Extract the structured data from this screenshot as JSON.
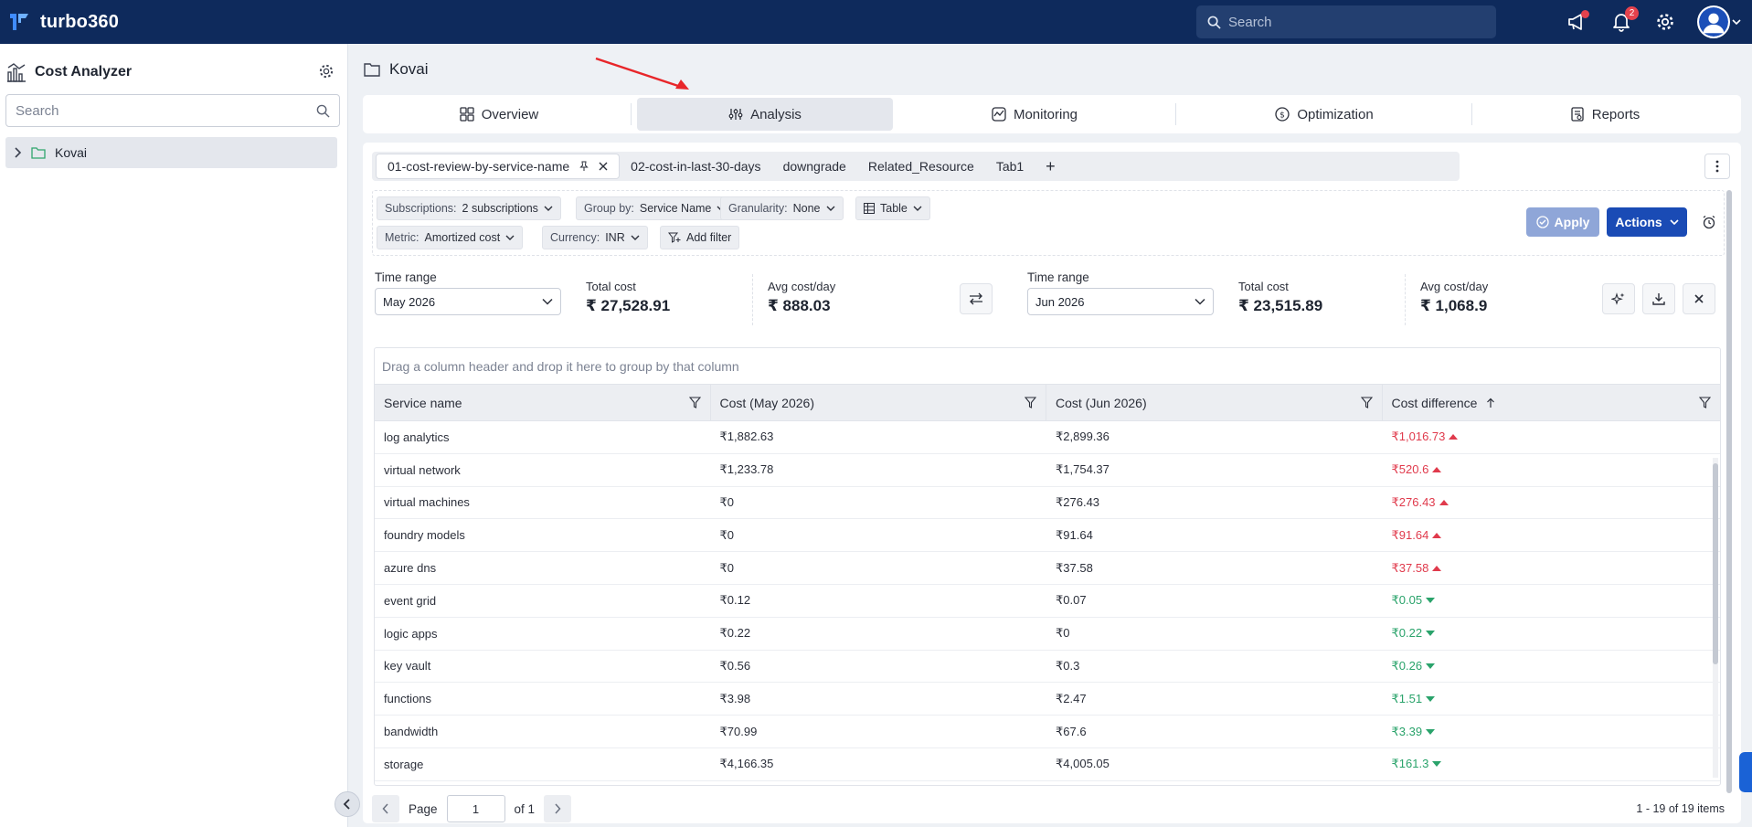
{
  "app": {
    "logo_text": "turbo360"
  },
  "topbar": {
    "search_placeholder": "Search",
    "notification_count": "2",
    "colors": {
      "bg": "#0e2a5c",
      "badge": "#e5424d"
    }
  },
  "sidebar": {
    "title": "Cost Analyzer",
    "search_placeholder": "Search",
    "tree": [
      {
        "label": "Kovai"
      }
    ]
  },
  "breadcrumb": {
    "title": "Kovai"
  },
  "nav_tabs": [
    {
      "label": "Overview",
      "icon": "grid-icon"
    },
    {
      "label": "Analysis",
      "icon": "analysis-icon",
      "active": true
    },
    {
      "label": "Monitoring",
      "icon": "monitoring-icon"
    },
    {
      "label": "Optimization",
      "icon": "dollar-icon"
    },
    {
      "label": "Reports",
      "icon": "report-icon"
    }
  ],
  "view_tabs": [
    {
      "label": "01-cost-review-by-service-name",
      "active": true,
      "pinned": true
    },
    {
      "label": "02-cost-in-last-30-days"
    },
    {
      "label": "downgrade"
    },
    {
      "label": "Related_Resource"
    },
    {
      "label": "Tab1"
    }
  ],
  "view_tab_add": "+",
  "filters": {
    "subscriptions": {
      "key": "Subscriptions:",
      "value": "2 subscriptions"
    },
    "group_by": {
      "key": "Group by:",
      "value": "Service Name"
    },
    "granularity": {
      "key": "Granularity:",
      "value": "None"
    },
    "view": {
      "value": "Table"
    },
    "metric": {
      "key": "Metric:",
      "value": "Amortized cost"
    },
    "currency": {
      "key": "Currency:",
      "value": "INR"
    },
    "add_filter": "Add filter",
    "apply_label": "Apply",
    "actions_label": "Actions"
  },
  "summary": {
    "left": {
      "time_range_label": "Time range",
      "time_range_value": "May 2026",
      "total_cost_label": "Total cost",
      "total_cost_value": "₹ 27,528.91",
      "avg_label": "Avg cost/day",
      "avg_value": "₹ 888.03"
    },
    "right": {
      "time_range_label": "Time range",
      "time_range_value": "Jun 2026",
      "total_cost_label": "Total cost",
      "total_cost_value": "₹ 23,515.89",
      "avg_label": "Avg cost/day",
      "avg_value": "₹ 1,068.9"
    }
  },
  "grid": {
    "group_hint": "Drag a column header and drop it here to group by that column",
    "columns": [
      "Service name",
      "Cost (May 2026)",
      "Cost (Jun 2026)",
      "Cost difference"
    ],
    "rows": [
      {
        "service": "log analytics",
        "may": "₹1,882.63",
        "jun": "₹2,899.36",
        "diff": "₹1,016.73",
        "trend": "up"
      },
      {
        "service": "virtual network",
        "may": "₹1,233.78",
        "jun": "₹1,754.37",
        "diff": "₹520.6",
        "trend": "up"
      },
      {
        "service": "virtual machines",
        "may": "₹0",
        "jun": "₹276.43",
        "diff": "₹276.43",
        "trend": "up"
      },
      {
        "service": "foundry models",
        "may": "₹0",
        "jun": "₹91.64",
        "diff": "₹91.64",
        "trend": "up"
      },
      {
        "service": "azure dns",
        "may": "₹0",
        "jun": "₹37.58",
        "diff": "₹37.58",
        "trend": "up"
      },
      {
        "service": "event grid",
        "may": "₹0.12",
        "jun": "₹0.07",
        "diff": "₹0.05",
        "trend": "down"
      },
      {
        "service": "logic apps",
        "may": "₹0.22",
        "jun": "₹0",
        "diff": "₹0.22",
        "trend": "down"
      },
      {
        "service": "key vault",
        "may": "₹0.56",
        "jun": "₹0.3",
        "diff": "₹0.26",
        "trend": "down"
      },
      {
        "service": "functions",
        "may": "₹3.98",
        "jun": "₹2.47",
        "diff": "₹1.51",
        "trend": "down"
      },
      {
        "service": "bandwidth",
        "may": "₹70.99",
        "jun": "₹67.6",
        "diff": "₹3.39",
        "trend": "down"
      },
      {
        "service": "storage",
        "may": "₹4,166.35",
        "jun": "₹4,005.05",
        "diff": "₹161.3",
        "trend": "down"
      }
    ]
  },
  "pager": {
    "page_label": "Page",
    "page_value": "1",
    "of_label": "of 1",
    "items_label": "1 - 19 of 19 items"
  }
}
